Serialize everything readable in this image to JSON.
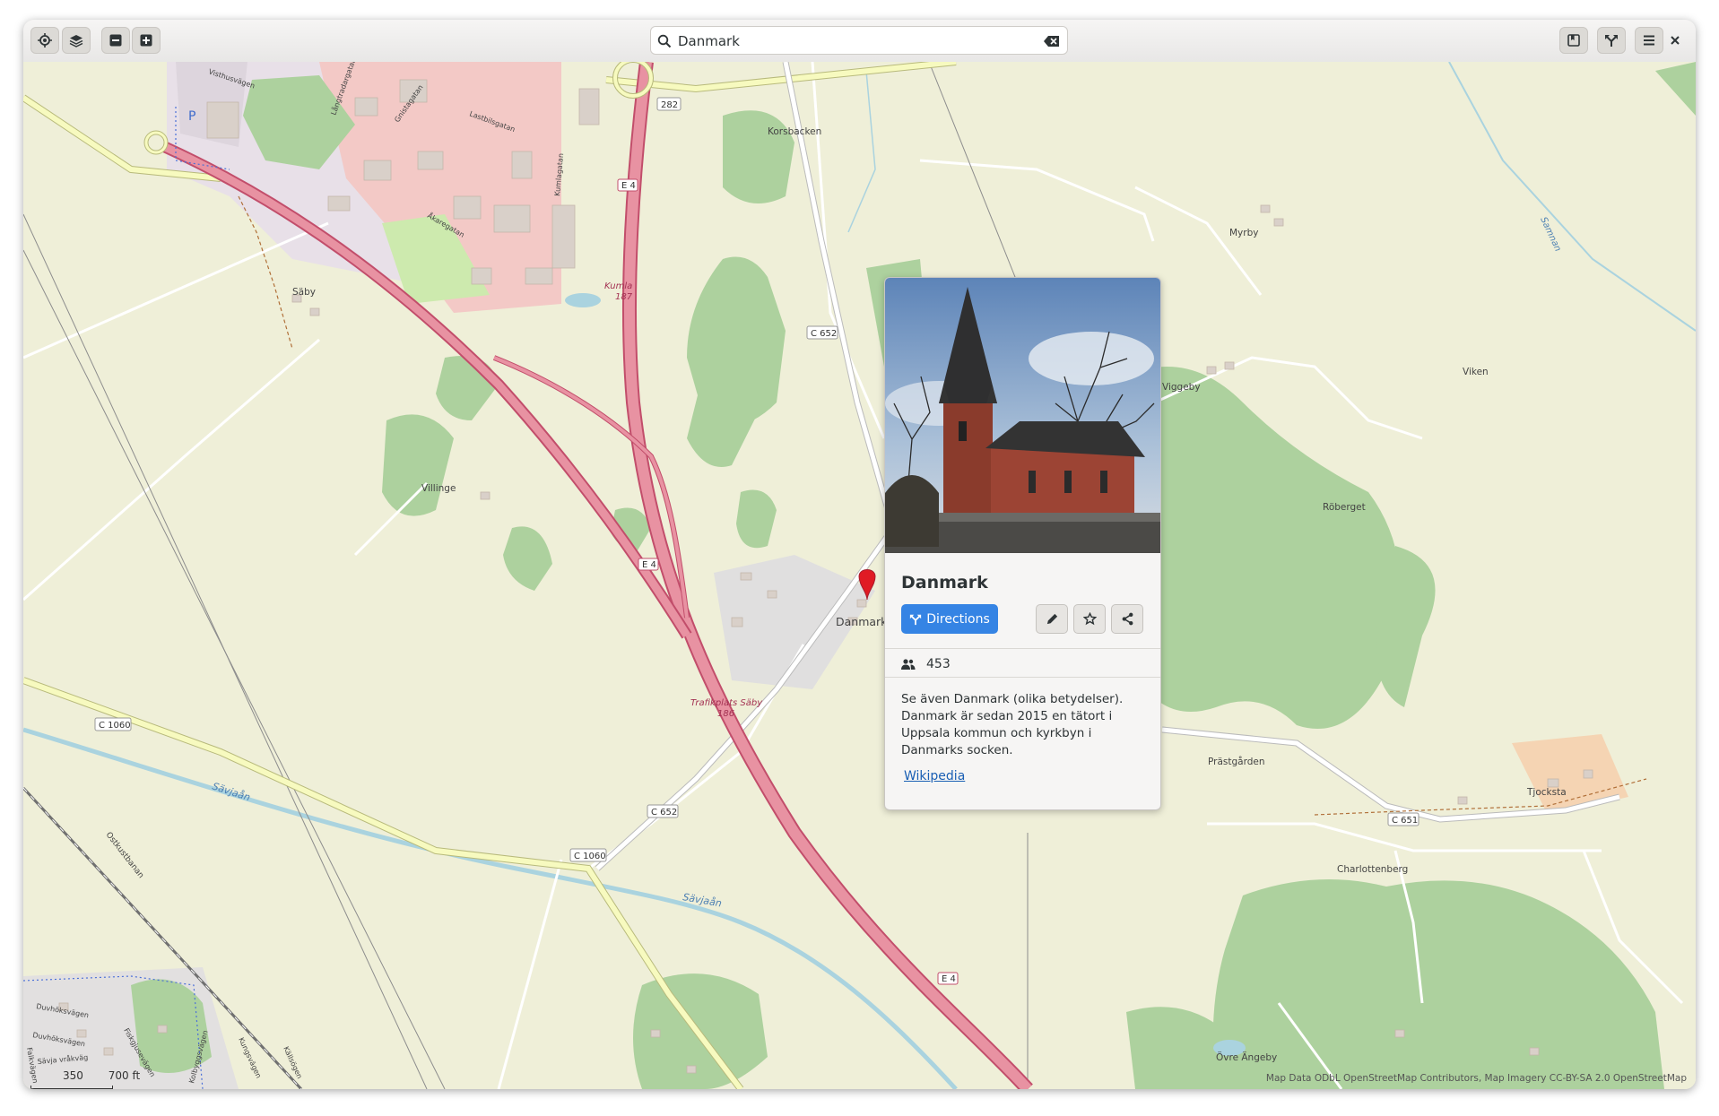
{
  "search": {
    "value": "Danmark"
  },
  "place": {
    "title": "Danmark",
    "directions_label": "Directions",
    "population": "453",
    "description": "Se även Danmark (olika betydelser). Danmark är sedan 2015 en tätort i Uppsala kommun och kyrkbyn i Danmarks socken.",
    "wikipedia_label": "Wikipedia"
  },
  "map": {
    "marker_label": "Danmark",
    "scale": {
      "metric": "350",
      "imperial": "700 ft"
    },
    "attribution": "Map Data ODbL OpenStreetMap Contributors, Map Imagery CC-BY-SA 2.0 OpenStreetMap",
    "place_labels": [
      "Korsbacken",
      "Myrby",
      "Säby",
      "Viken",
      "Viggeby",
      "Villinge",
      "Röberget",
      "Prästgården",
      "Tjocksta",
      "Charlottenberg",
      "Övre Ängeby"
    ],
    "street_labels": [
      "Visthusvägen",
      "Långtradargatan",
      "Gnistagatan",
      "Lastbilsgatan",
      "Kumlagatan",
      "Åkaregatan",
      "Duvhöksvägen",
      "Duvhöksvägen",
      "Sävja vråkväg",
      "Kolbyggsvägen",
      "Falkvägen",
      "Fiskgjusevägen",
      "Kungsvägen",
      "Källsögen",
      "Ostkustbanan",
      "Samnan"
    ],
    "water_labels": [
      "Sävjaån",
      "Sävjaån"
    ],
    "junction_labels": [
      {
        "name": "Kumla",
        "number": "187"
      },
      {
        "name": "Trafikplats Säby",
        "number": "186"
      }
    ],
    "road_refs": [
      "282",
      "E 4",
      "E 4",
      "E 4",
      "C 652",
      "C 652",
      "C 1060",
      "C 1060",
      "C 651"
    ]
  },
  "colors": {
    "accent": "#3584e4",
    "motorway": "#e892a2",
    "motorway_casing": "#c24e6b",
    "secondary_road": "#f7fabf",
    "forest": "#add19e",
    "water": "#aad3df",
    "land": "#efefd8",
    "marker": "#e01b24"
  },
  "icons": [
    "locate-icon",
    "layers-icon",
    "zoom-out-icon",
    "zoom-in-icon",
    "search-icon",
    "clear-icon",
    "bookmarks-icon",
    "route-icon",
    "menu-icon",
    "close-icon",
    "directions-icon",
    "edit-icon",
    "favorite-star-icon",
    "share-icon",
    "population-icon",
    "map-marker-icon"
  ]
}
